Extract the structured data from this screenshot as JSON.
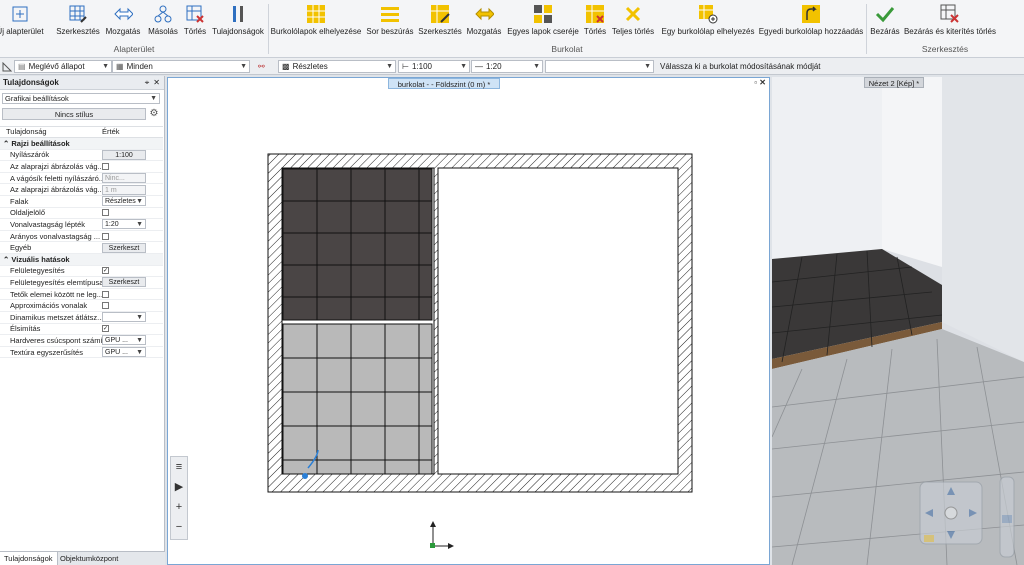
{
  "ribbon": {
    "groups": [
      {
        "label": "Alapterület",
        "buttons": [
          {
            "label": "Új alapterület",
            "icon": "new-floor-icon"
          },
          {
            "label": "Szerkesztés",
            "icon": "grid-edit-icon"
          },
          {
            "label": "Mozgatás",
            "icon": "move-arrows-icon"
          },
          {
            "label": "Másolás",
            "icon": "copy-nodes-icon"
          },
          {
            "label": "Törlés",
            "icon": "delete-grid-icon"
          },
          {
            "label": "Tulajdonságok",
            "icon": "tools-icon"
          }
        ]
      },
      {
        "label": "Burkolat",
        "buttons": [
          {
            "label": "Burkolólapok elhelyezése",
            "icon": "tiles-place-icon"
          },
          {
            "label": "Sor beszúrás",
            "icon": "row-insert-icon"
          },
          {
            "label": "Szerkesztés",
            "icon": "tile-edit-icon"
          },
          {
            "label": "Mozgatás",
            "icon": "tile-move-icon"
          },
          {
            "label": "Egyes lapok cseréje",
            "icon": "tile-swap-icon"
          },
          {
            "label": "Törlés",
            "icon": "tile-delete-icon"
          },
          {
            "label": "Teljes törlés",
            "icon": "delete-all-icon"
          },
          {
            "label": "Egy burkolólap elhelyezés",
            "icon": "single-tile-icon"
          },
          {
            "label": "Egyedi burkolólap hozzáadás",
            "icon": "custom-tile-icon"
          }
        ]
      },
      {
        "label": "Szerkesztés",
        "buttons": [
          {
            "label": "Bezárás",
            "icon": "checkmark-icon"
          },
          {
            "label": "Bezárás és kiterítés törlés",
            "icon": "close-delete-icon"
          }
        ]
      }
    ]
  },
  "toolbar2": {
    "state_label": "Meglévő állapot",
    "filter_label": "Minden",
    "detail_label": "Részletes",
    "scale_label": "1:100",
    "line_scale_label": "1:20",
    "layer_value": "",
    "hint": "Válassza ki a burkolat módosításának módját"
  },
  "properties": {
    "panel_title": "Tulajdonságok",
    "category": "Grafikai beállítások",
    "style_label": "Nincs stílus",
    "col_property": "Tulajdonság",
    "col_value": "Érték",
    "rows": [
      {
        "type": "section",
        "label": "Rajzi beállítások"
      },
      {
        "type": "button",
        "label": "Nyílászárók",
        "value": "1:100"
      },
      {
        "type": "check",
        "label": "Az alaprajzi ábrázolás vág...",
        "value": ""
      },
      {
        "type": "disabled",
        "label": "A vágósík feletti nyílászáró...",
        "value": "Ninc..."
      },
      {
        "type": "disabled",
        "label": "Az alaprajzi ábrázolás vág...",
        "value": "1 m"
      },
      {
        "type": "dropdown",
        "label": "Falak",
        "value": "Részletes"
      },
      {
        "type": "check",
        "label": "Oldaljelölő",
        "value": ""
      },
      {
        "type": "dropdown",
        "label": "Vonalvastagság lépték",
        "value": "1:20"
      },
      {
        "type": "check",
        "label": "Arányos vonalvastagság ...",
        "value": ""
      },
      {
        "type": "button",
        "label": "Egyéb",
        "value": "Szerkeszt"
      },
      {
        "type": "section",
        "label": "Vizuális hatások"
      },
      {
        "type": "check",
        "label": "Felületegyesítés",
        "value": "✓"
      },
      {
        "type": "button",
        "label": "Felületegyesítés elemtípusai",
        "value": "Szerkeszt"
      },
      {
        "type": "check",
        "label": "Tetők elemei között ne leg...",
        "value": ""
      },
      {
        "type": "check",
        "label": "Approximációs vonalak",
        "value": ""
      },
      {
        "type": "dropdown",
        "label": "Dinamikus metszet átlátsz...",
        "value": ""
      },
      {
        "type": "check",
        "label": "Élsimítás",
        "value": "✓"
      },
      {
        "type": "dropdown",
        "label": "Hardveres csúcspont számítás",
        "value": "GPU ..."
      },
      {
        "type": "dropdown",
        "label": "Textúra egyszerűsítés",
        "value": "GPU ..."
      }
    ],
    "bottom_tabs": [
      "Tulajdonságok",
      "Objektumközpont"
    ]
  },
  "plan_view": {
    "tab_title": "burkolat -  - Földszint (0 m) *",
    "controls": "▫ ✕",
    "floor_tile_color": "#4a4545",
    "bath_tile_color": "#b9b9b9"
  },
  "view3d": {
    "tab_title": "Nézet 2 [Kép] *"
  },
  "colors": {
    "ribbon_yellow": "#f2c200",
    "accent_blue": "#2e6fc0",
    "check_green": "#3a9a3a",
    "delete_red": "#cc3333"
  }
}
